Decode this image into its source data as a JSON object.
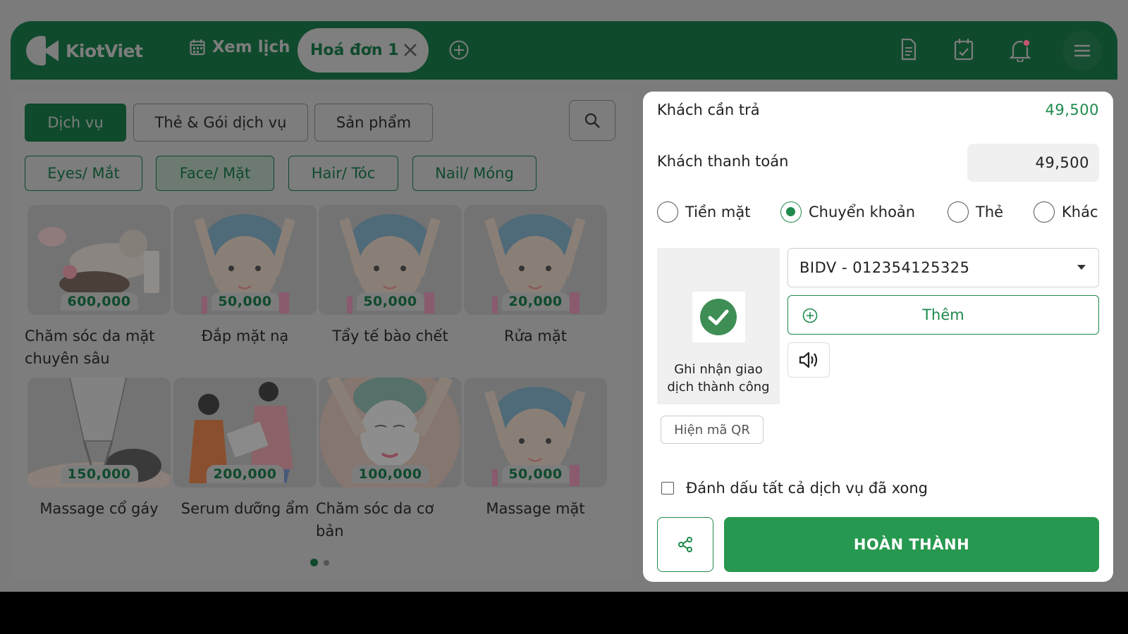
{
  "header": {
    "brand": "KiotViet",
    "schedule_label": "Xem lịch",
    "active_tab": "Hoá đơn 1",
    "icons": [
      "calendar-icon",
      "close-icon",
      "add-tab-icon",
      "invoice-icon",
      "calendar-check-icon",
      "bell-icon",
      "menu-icon"
    ]
  },
  "left": {
    "categories": [
      "Dịch vụ",
      "Thẻ & Gói dịch vụ",
      "Sản phẩm"
    ],
    "subcategories": [
      "Eyes/ Mắt",
      "Face/ Mặt",
      "Hair/ Tóc",
      "Nail/ Móng"
    ],
    "services": [
      {
        "name": "Chăm sóc da mặt chuyên sâu",
        "price": "600,000"
      },
      {
        "name": "Đắp mặt nạ",
        "price": "50,000"
      },
      {
        "name": "Tẩy tế bào chết",
        "price": "50,000"
      },
      {
        "name": "Rửa mặt",
        "price": "20,000"
      },
      {
        "name": "Massage cổ gáy",
        "price": "150,000"
      },
      {
        "name": "Serum dưỡng ẩm",
        "price": "200,000"
      },
      {
        "name": "Chăm sóc da cơ bản",
        "price": "100,000"
      },
      {
        "name": "Massage mặt",
        "price": "50,000"
      }
    ]
  },
  "payment": {
    "due_label": "Khách cần trả",
    "due_value": "49,500",
    "paid_label": "Khách thanh toán",
    "paid_value": "49,500",
    "methods": [
      "Tiền mặt",
      "Chuyển khoản",
      "Thẻ",
      "Khác"
    ],
    "selected_method": "Chuyển khoản",
    "success_msg": "Ghi nhận giao dịch thành công",
    "show_qr": "Hiện mã QR",
    "bank_account": "BIDV - 012354125325",
    "add_label": "Thêm",
    "mark_all_label": "Đánh dấu tất cả dịch vụ đã xong",
    "finish_label": "HOÀN THÀNH"
  },
  "colors": {
    "brand_green": "#0f4a2c",
    "accent_green": "#27984f",
    "overlay_gray": "#7b7b7b"
  }
}
